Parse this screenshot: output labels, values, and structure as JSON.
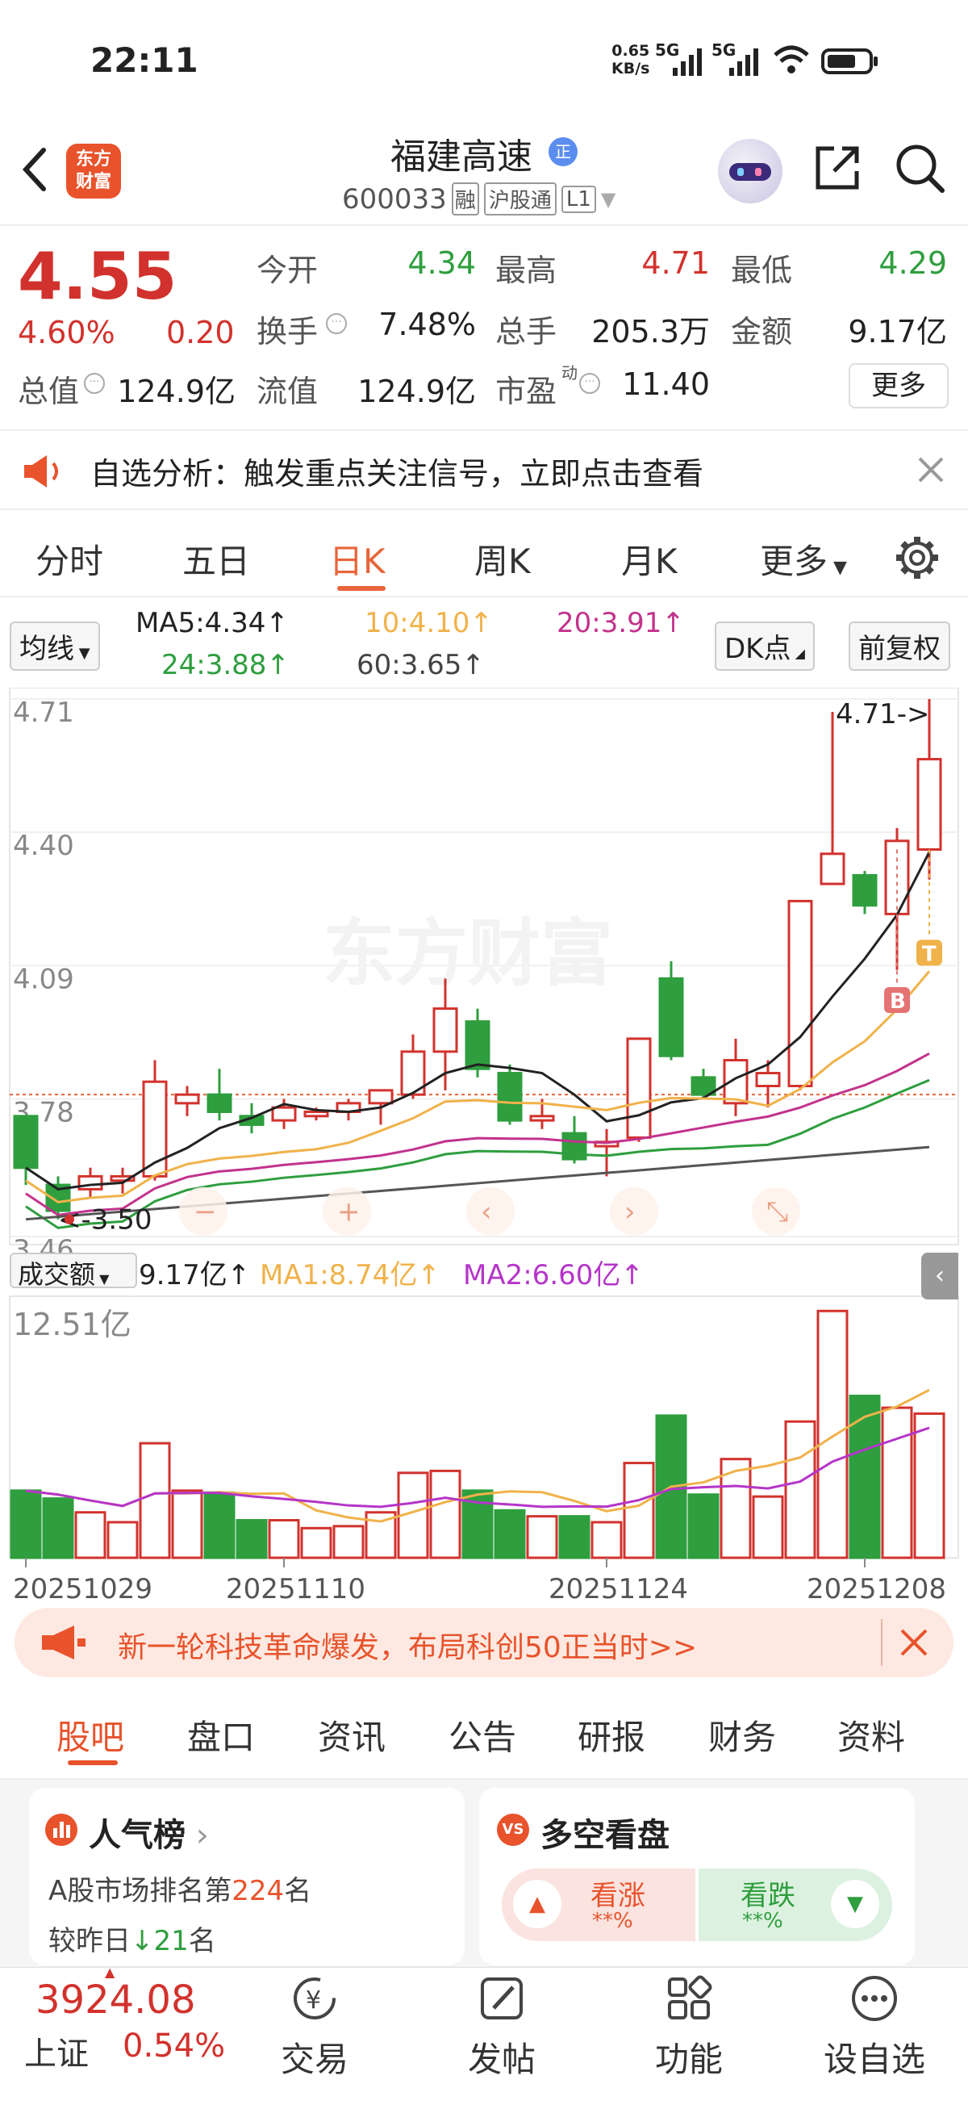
{
  "status": {
    "time": "22:11",
    "speed": "0.65",
    "speed_unit": "KB/s",
    "net1": "5G",
    "net2": "5G"
  },
  "nav": {
    "title": "福建高速",
    "badge": "正",
    "logo_line1": "东方",
    "logo_line2": "财富",
    "code": "600033",
    "tag1": "融",
    "tag2": "沪股通",
    "tag3": "L1"
  },
  "quote": {
    "price": "4.55",
    "pct": "4.60%",
    "change": "0.20",
    "row1": [
      {
        "label": "今开",
        "value": "4.34"
      },
      {
        "label": "最高",
        "value": "4.71"
      },
      {
        "label": "最低",
        "value": "4.29"
      }
    ],
    "row2": [
      {
        "label": "换手",
        "value": "7.48%"
      },
      {
        "label": "总手",
        "value": "205.3万"
      },
      {
        "label": "金额",
        "value": "9.17亿"
      }
    ],
    "row3": [
      {
        "label": "总值",
        "value": "124.9亿"
      },
      {
        "label": "流值",
        "value": "124.9亿"
      },
      {
        "label": "市盈",
        "sup": "动",
        "value": "11.40"
      }
    ],
    "more": "更多"
  },
  "banner1": {
    "text": "自选分析：触发重点关注信号，立即点击查看"
  },
  "tabs": [
    "分时",
    "五日",
    "日K",
    "周K",
    "月K",
    "更多"
  ],
  "active_tab": 2,
  "ma": {
    "selector": "均线",
    "ma5": "MA5:4.34",
    "ma10": "10:4.10",
    "ma20": "20:3.91",
    "ma24": "24:3.88",
    "ma60": "60:3.65",
    "dk": "DK点",
    "fq": "前复权",
    "arrow": "↑"
  },
  "chart_data": {
    "type": "candlestick",
    "y_ticks": [
      "4.71",
      "4.40",
      "4.09",
      "3.78",
      "3.46"
    ],
    "ylim": [
      3.46,
      4.71
    ],
    "high_marker": "4.71->",
    "low_marker": "3.50",
    "markers": [
      "B",
      "T"
    ],
    "candles": [
      {
        "o": 3.74,
        "c": 3.62,
        "h": 3.74,
        "l": 3.58
      },
      {
        "o": 3.58,
        "c": 3.52,
        "h": 3.6,
        "l": 3.5
      },
      {
        "o": 3.57,
        "c": 3.6,
        "h": 3.62,
        "l": 3.55
      },
      {
        "o": 3.59,
        "c": 3.6,
        "h": 3.62,
        "l": 3.56
      },
      {
        "o": 3.6,
        "c": 3.82,
        "h": 3.87,
        "l": 3.59
      },
      {
        "o": 3.77,
        "c": 3.79,
        "h": 3.81,
        "l": 3.74
      },
      {
        "o": 3.79,
        "c": 3.75,
        "h": 3.85,
        "l": 3.73
      },
      {
        "o": 3.74,
        "c": 3.72,
        "h": 3.77,
        "l": 3.7
      },
      {
        "o": 3.73,
        "c": 3.76,
        "h": 3.78,
        "l": 3.71
      },
      {
        "o": 3.74,
        "c": 3.75,
        "h": 3.76,
        "l": 3.73
      },
      {
        "o": 3.75,
        "c": 3.77,
        "h": 3.78,
        "l": 3.73
      },
      {
        "o": 3.77,
        "c": 3.8,
        "h": 3.8,
        "l": 3.72
      },
      {
        "o": 3.79,
        "c": 3.89,
        "h": 3.93,
        "l": 3.78
      },
      {
        "o": 3.89,
        "c": 3.99,
        "h": 4.06,
        "l": 3.8
      },
      {
        "o": 3.96,
        "c": 3.85,
        "h": 3.99,
        "l": 3.83
      },
      {
        "o": 3.84,
        "c": 3.73,
        "h": 3.86,
        "l": 3.72
      },
      {
        "o": 3.73,
        "c": 3.74,
        "h": 3.78,
        "l": 3.71
      },
      {
        "o": 3.7,
        "c": 3.64,
        "h": 3.74,
        "l": 3.63
      },
      {
        "o": 3.67,
        "c": 3.68,
        "h": 3.71,
        "l": 3.6
      },
      {
        "o": 3.69,
        "c": 3.92,
        "h": 3.92,
        "l": 3.68
      },
      {
        "o": 4.06,
        "c": 3.88,
        "h": 4.1,
        "l": 3.87
      },
      {
        "o": 3.83,
        "c": 3.79,
        "h": 3.85,
        "l": 3.78
      },
      {
        "o": 3.77,
        "c": 3.87,
        "h": 3.92,
        "l": 3.74
      },
      {
        "o": 3.81,
        "c": 3.84,
        "h": 3.87,
        "l": 3.76
      },
      {
        "o": 3.81,
        "c": 4.24,
        "h": 4.24,
        "l": 3.8
      },
      {
        "o": 4.28,
        "c": 4.35,
        "h": 4.68,
        "l": 4.28
      },
      {
        "o": 4.3,
        "c": 4.23,
        "h": 4.31,
        "l": 4.21
      },
      {
        "o": 4.21,
        "c": 4.38,
        "h": 4.41,
        "l": 4.08
      },
      {
        "o": 4.36,
        "c": 4.57,
        "h": 4.71,
        "l": 4.29
      }
    ],
    "volume_label": "成交额",
    "volume_value": "9.17亿",
    "vol_ma1": "MA1:8.74亿",
    "vol_ma2": "MA2:6.60亿",
    "volume_max": "12.51亿",
    "volumes": [
      3.4,
      3.0,
      2.3,
      1.8,
      5.8,
      3.4,
      3.3,
      1.9,
      1.9,
      1.5,
      1.6,
      2.3,
      4.3,
      4.4,
      3.4,
      2.4,
      2.1,
      2.1,
      1.8,
      4.8,
      7.2,
      3.2,
      5.0,
      3.1,
      6.9,
      12.5,
      8.2,
      7.6,
      7.3
    ],
    "x_labels": [
      "20251029",
      "20251110",
      "20251124",
      "20251208"
    ]
  },
  "banner2": {
    "text": "新一轮科技革命爆发，布局科创50正当时>>"
  },
  "subtabs": [
    "股吧",
    "盘口",
    "资讯",
    "公告",
    "研报",
    "财务",
    "资料"
  ],
  "popular": {
    "title": "人气榜",
    "rank_prefix": "A股市场排名第",
    "rank": "224",
    "rank_suffix": "名",
    "change_prefix": "较昨日",
    "change": "21",
    "change_suffix": "名"
  },
  "duokong": {
    "title": "多空看盘",
    "up_label": "看涨",
    "up_value": "**%",
    "down_label": "看跌",
    "down_value": "**%"
  },
  "index": {
    "value": "3924.08",
    "name": "上证",
    "pct": "0.54%"
  },
  "bottom": [
    {
      "label": "交易",
      "icon": "trade-icon"
    },
    {
      "label": "发帖",
      "icon": "post-icon"
    },
    {
      "label": "功能",
      "icon": "grid-icon"
    },
    {
      "label": "设自选",
      "icon": "more-icon"
    }
  ],
  "colors": {
    "up": "#d2322d",
    "down": "#2e9e3e",
    "accent": "#e8663a",
    "ma5": "#222222",
    "ma10": "#f0b24a",
    "ma20": "#c2338c",
    "ma24": "#2e9e3e",
    "ma60": "#555555",
    "volma2": "#b535c9"
  }
}
